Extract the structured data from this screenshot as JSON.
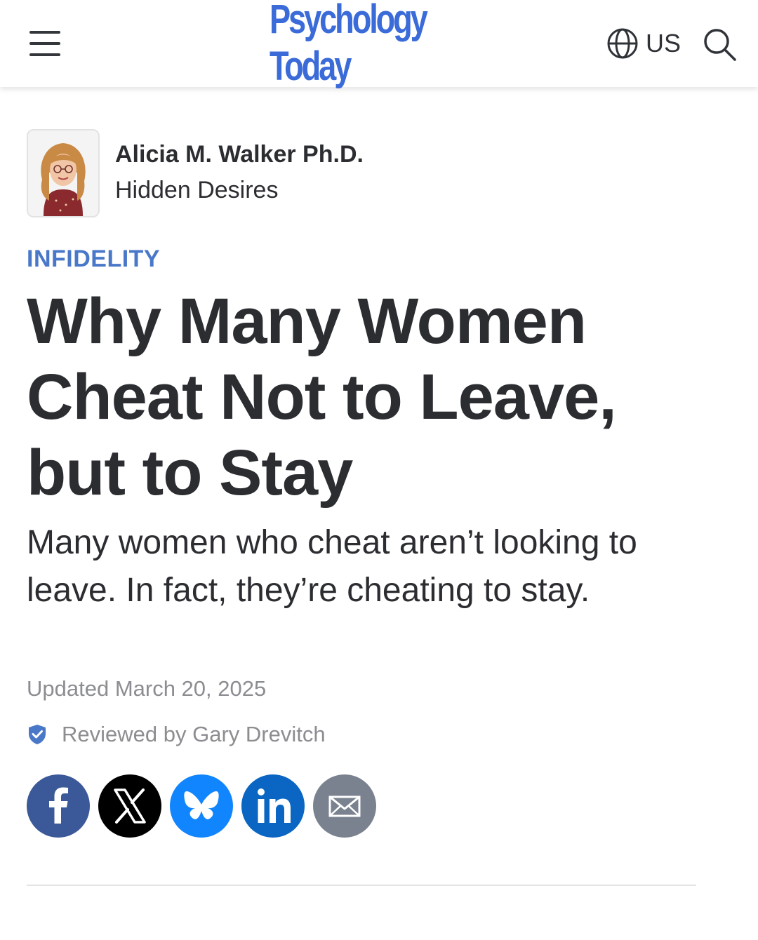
{
  "header": {
    "logo_text": "Psychology Today",
    "region_label": "US",
    "logo_color": "#3a6bd8"
  },
  "author": {
    "name": "Alicia M. Walker Ph.D.",
    "blog": "Hidden Desires"
  },
  "article": {
    "category": "INFIDELITY",
    "title": "Why Many Women Cheat Not to Leave, but to Stay",
    "dek": "Many women who cheat aren’t looking to leave. In fact, they’re cheating to stay.",
    "updated": "Updated March 20, 2025",
    "reviewed_by": "Reviewed by Gary Drevitch"
  },
  "share": {
    "buttons": [
      {
        "icon": "facebook-icon",
        "color": "#3b5998"
      },
      {
        "icon": "x-icon",
        "color": "#000000"
      },
      {
        "icon": "bluesky-icon",
        "color": "#1185fe"
      },
      {
        "icon": "linkedin-icon",
        "color": "#0a66c2"
      },
      {
        "icon": "email-icon",
        "color": "#7a8290"
      }
    ]
  },
  "colors": {
    "accent": "#4a78c9",
    "text": "#2b2d31",
    "muted": "#8b8d91"
  }
}
